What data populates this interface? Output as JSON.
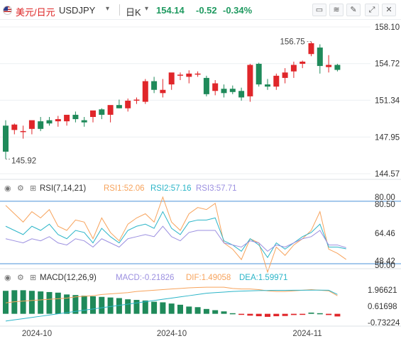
{
  "header": {
    "symbol": "美元/日元",
    "code": "USDJPY",
    "code_caret": "▾",
    "period": "日K",
    "period_caret": "▾",
    "price": "154.14",
    "change": "-0.52",
    "change_pct": "-0.34%",
    "tools": [
      "chart-settings-icon",
      "indicator-icon",
      "draw-icon",
      "expand-icon",
      "close-icon"
    ]
  },
  "colors": {
    "up": "#e0262a",
    "down": "#1f8a5a",
    "rsi1": "#f7a35c",
    "rsi2": "#2bb5c8",
    "rsi3": "#9b8fe0",
    "dif": "#f7a35c",
    "dea": "#2bb5c8",
    "grid": "#eceff2",
    "ref_line": "#4a90d9"
  },
  "chart_data": [
    {
      "type": "candlestick",
      "title": "",
      "y_ticks": [
        "158.10",
        "154.72",
        "151.34",
        "147.95",
        "144.57"
      ],
      "ylim": [
        144.57,
        158.1
      ],
      "annotations": {
        "high": "156.75",
        "low": "145.92"
      },
      "candles": [
        {
          "o": 149.0,
          "h": 149.5,
          "l": 145.92,
          "c": 146.6
        },
        {
          "o": 148.6,
          "h": 149.2,
          "l": 148.2,
          "c": 149.1
        },
        {
          "o": 148.5,
          "h": 149.0,
          "l": 147.8,
          "c": 148.5
        },
        {
          "o": 148.7,
          "h": 149.4,
          "l": 148.2,
          "c": 149.5
        },
        {
          "o": 149.4,
          "h": 149.8,
          "l": 148.5,
          "c": 148.7
        },
        {
          "o": 149.5,
          "h": 149.8,
          "l": 149.0,
          "c": 149.2
        },
        {
          "o": 149.4,
          "h": 149.9,
          "l": 148.9,
          "c": 149.6
        },
        {
          "o": 149.4,
          "h": 149.7,
          "l": 149.0,
          "c": 150.0
        },
        {
          "o": 150.0,
          "h": 150.3,
          "l": 149.3,
          "c": 149.6
        },
        {
          "o": 149.5,
          "h": 149.8,
          "l": 148.9,
          "c": 149.3
        },
        {
          "o": 149.8,
          "h": 150.2,
          "l": 149.3,
          "c": 150.4
        },
        {
          "o": 150.5,
          "h": 150.6,
          "l": 149.6,
          "c": 150.0
        },
        {
          "o": 150.0,
          "h": 150.8,
          "l": 149.3,
          "c": 150.9
        },
        {
          "o": 150.9,
          "h": 151.4,
          "l": 150.6,
          "c": 150.6
        },
        {
          "o": 150.6,
          "h": 151.5,
          "l": 150.3,
          "c": 151.3
        },
        {
          "o": 151.4,
          "h": 151.6,
          "l": 151.0,
          "c": 151.4
        },
        {
          "o": 151.2,
          "h": 153.3,
          "l": 151.0,
          "c": 153.1
        },
        {
          "o": 153.1,
          "h": 153.5,
          "l": 152.0,
          "c": 152.3
        },
        {
          "o": 152.0,
          "h": 153.3,
          "l": 151.6,
          "c": 152.3
        },
        {
          "o": 152.8,
          "h": 153.8,
          "l": 152.3,
          "c": 153.9
        },
        {
          "o": 153.7,
          "h": 153.9,
          "l": 153.2,
          "c": 153.7
        },
        {
          "o": 153.5,
          "h": 154.1,
          "l": 152.9,
          "c": 153.8
        },
        {
          "o": 153.8,
          "h": 154.0,
          "l": 153.5,
          "c": 153.8
        },
        {
          "o": 153.4,
          "h": 153.6,
          "l": 151.7,
          "c": 151.9
        },
        {
          "o": 152.2,
          "h": 153.2,
          "l": 151.8,
          "c": 152.9
        },
        {
          "o": 152.4,
          "h": 152.8,
          "l": 151.6,
          "c": 152.0
        },
        {
          "o": 152.4,
          "h": 152.7,
          "l": 151.9,
          "c": 152.1
        },
        {
          "o": 152.2,
          "h": 152.5,
          "l": 151.3,
          "c": 151.6
        },
        {
          "o": 151.7,
          "h": 154.7,
          "l": 151.2,
          "c": 154.6
        },
        {
          "o": 154.7,
          "h": 154.8,
          "l": 152.6,
          "c": 152.8
        },
        {
          "o": 152.8,
          "h": 153.3,
          "l": 152.3,
          "c": 152.6
        },
        {
          "o": 152.6,
          "h": 153.8,
          "l": 152.3,
          "c": 153.6
        },
        {
          "o": 153.4,
          "h": 154.3,
          "l": 152.9,
          "c": 153.9
        },
        {
          "o": 154.0,
          "h": 154.9,
          "l": 153.4,
          "c": 154.6
        },
        {
          "o": 154.7,
          "h": 155.0,
          "l": 154.3,
          "c": 154.9
        },
        {
          "o": 155.6,
          "h": 156.75,
          "l": 155.4,
          "c": 156.6
        },
        {
          "o": 156.2,
          "h": 156.5,
          "l": 153.8,
          "c": 154.5
        },
        {
          "o": 154.4,
          "h": 155.5,
          "l": 153.9,
          "c": 154.6
        },
        {
          "o": 154.6,
          "h": 154.7,
          "l": 154.0,
          "c": 154.14
        }
      ]
    },
    {
      "type": "line",
      "title": "RSI(7,14,21)",
      "ylim": [
        50.0,
        82.0
      ],
      "y_ticks": [
        "80.00",
        "80.50",
        "64.46",
        "48.42",
        "50.00"
      ],
      "ref_lines": [
        80.0,
        50.0
      ],
      "series": [
        {
          "name": "RSI1:52.06",
          "values": [
            78,
            74,
            70,
            75,
            72,
            76,
            68,
            66,
            71,
            70,
            62,
            72,
            65,
            61,
            69,
            72,
            74,
            70,
            82,
            70,
            66,
            74,
            77,
            76,
            79,
            60,
            57,
            52,
            62,
            60,
            46,
            58,
            54,
            59,
            62,
            66,
            75,
            57,
            55,
            52.06
          ]
        },
        {
          "name": "RSI2:57.16",
          "values": [
            68,
            66,
            64,
            68,
            66,
            69,
            64,
            62,
            66,
            65,
            60,
            67,
            63,
            60,
            66,
            68,
            69,
            67,
            75,
            67,
            64,
            70,
            71,
            71,
            72,
            61,
            59,
            56,
            62,
            59,
            53,
            60,
            57,
            60,
            63,
            65,
            69,
            58,
            58,
            57.16
          ]
        },
        {
          "name": "RSI3:57.71",
          "values": [
            62,
            61,
            60,
            62,
            61,
            63,
            60,
            59,
            62,
            61,
            58,
            62,
            60,
            58,
            62,
            63,
            64,
            63,
            68,
            63,
            61,
            65,
            66,
            66,
            66,
            60,
            59,
            58,
            61,
            60,
            56,
            59,
            58,
            60,
            62,
            63,
            66,
            59,
            59,
            57.71
          ]
        }
      ]
    },
    {
      "type": "bar",
      "title": "MACD(12,26,9)",
      "ylim": [
        -0.9,
        2.5
      ],
      "y_ticks": [
        "1.96621",
        "0.61698",
        "-0.73224"
      ],
      "series": [
        {
          "name": "MACD:-0.21826",
          "values": [
            1.9,
            1.95,
            1.95,
            1.9,
            1.85,
            1.8,
            1.75,
            1.6,
            1.55,
            1.5,
            1.45,
            1.4,
            1.35,
            1.3,
            1.2,
            1.15,
            1.1,
            1.0,
            0.95,
            0.85,
            0.75,
            0.6,
            0.55,
            0.4,
            0.3,
            0.2,
            0.05,
            -0.05,
            -0.15,
            -0.2,
            -0.25,
            -0.2,
            -0.18,
            -0.1,
            -0.05,
            0.1,
            0.05,
            -0.1,
            -0.21826
          ]
        },
        {
          "name": "DIF:1.49058",
          "values": [
            0.9,
            1.0,
            1.05,
            1.1,
            1.15,
            1.2,
            1.25,
            1.3,
            1.4,
            1.45,
            1.5,
            1.6,
            1.65,
            1.7,
            1.75,
            1.85,
            1.9,
            1.95,
            2.0,
            2.05,
            2.1,
            2.15,
            2.18,
            2.2,
            2.2,
            2.2,
            2.1,
            2.05,
            2.05,
            2.0,
            1.9,
            1.85,
            1.85,
            1.9,
            1.95,
            2.0,
            1.95,
            1.9,
            1.49058
          ]
        },
        {
          "name": "DEA:1.59971",
          "values": [
            -0.6,
            -0.5,
            -0.4,
            -0.3,
            -0.2,
            -0.1,
            0.0,
            0.1,
            0.2,
            0.3,
            0.4,
            0.5,
            0.6,
            0.7,
            0.8,
            0.9,
            1.0,
            1.1,
            1.2,
            1.3,
            1.4,
            1.5,
            1.6,
            1.7,
            1.75,
            1.8,
            1.85,
            1.88,
            1.9,
            1.92,
            1.93,
            1.94,
            1.94,
            1.95,
            1.95,
            1.96,
            1.96,
            1.95,
            1.59971
          ]
        }
      ]
    }
  ],
  "x_labels": [
    "2024-10",
    "2024-10",
    "2024-11"
  ]
}
